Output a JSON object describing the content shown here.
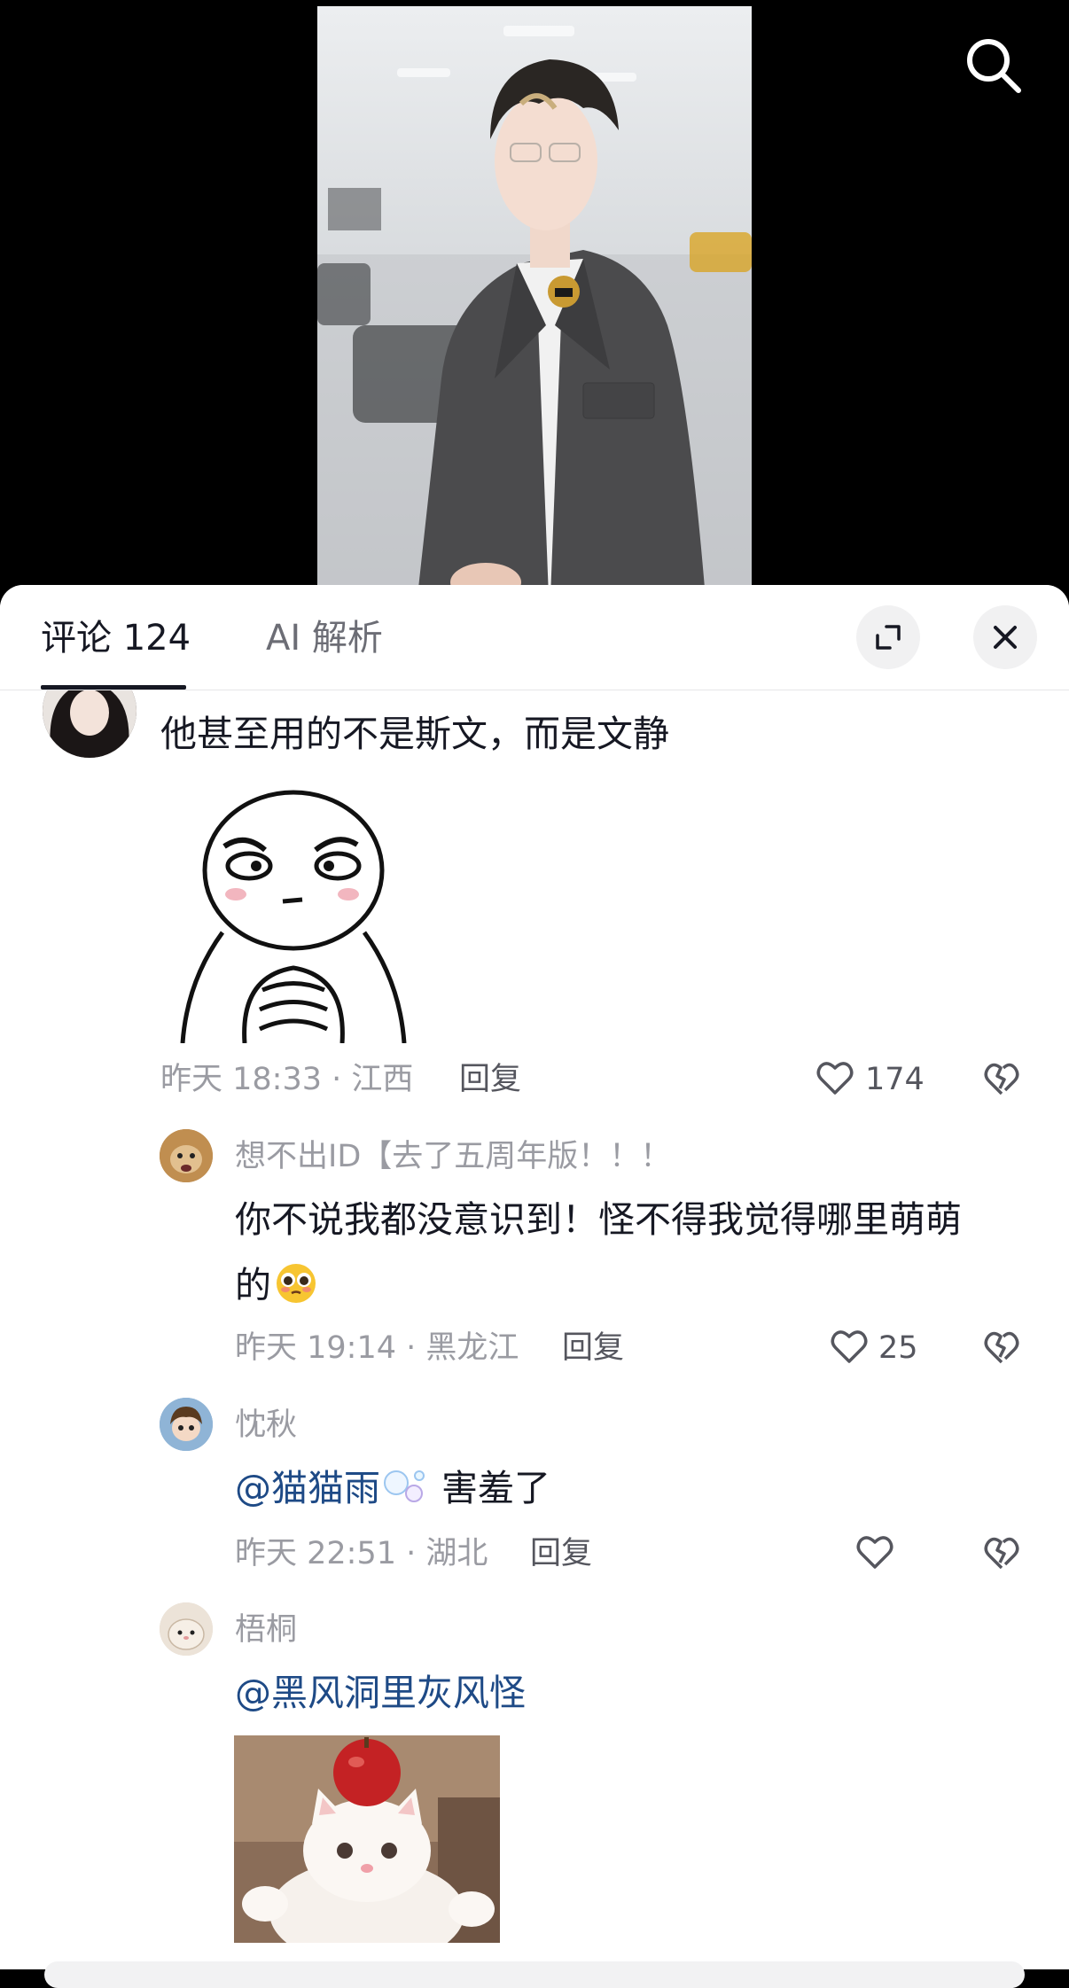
{
  "header": {
    "tabs": [
      {
        "label": "评论 124",
        "active": true
      },
      {
        "label": "AI 解析",
        "active": false
      }
    ],
    "icons": [
      "search-icon",
      "expand-icon",
      "close-icon"
    ]
  },
  "comments": [
    {
      "text": "他甚至用的不是斯文，而是文静",
      "time_location": "昨天 18:33 · 江西",
      "reply_label": "回复",
      "likes": "174",
      "sticker": "cartoon-clasped-hands-sticker"
    }
  ],
  "replies": [
    {
      "username": "想不出ID【去了五周年版！！！",
      "text_line1": "你不说我都没意识到！怪不得我觉得哪里萌萌",
      "text_line2": "的",
      "emoji": "pleading-face-emoji",
      "time_location": "昨天 19:14 · 黑龙江",
      "reply_label": "回复",
      "likes": "25"
    },
    {
      "username": "忱秋",
      "mention": "@猫猫雨",
      "mention_emoji": "bubbles-emoji",
      "text": " 害羞了",
      "time_location": "昨天 22:51 · 湖北",
      "reply_label": "回复",
      "likes": ""
    },
    {
      "username": "梧桐",
      "mention": "@黑风洞里灰风怪",
      "sticker": "kitten-with-apple-sticker"
    }
  ],
  "colors": {
    "mention": "#1e4a86",
    "meta": "#9a9ba2",
    "text": "#161823",
    "sheet": "#ffffff",
    "video_bg": "#000000"
  }
}
